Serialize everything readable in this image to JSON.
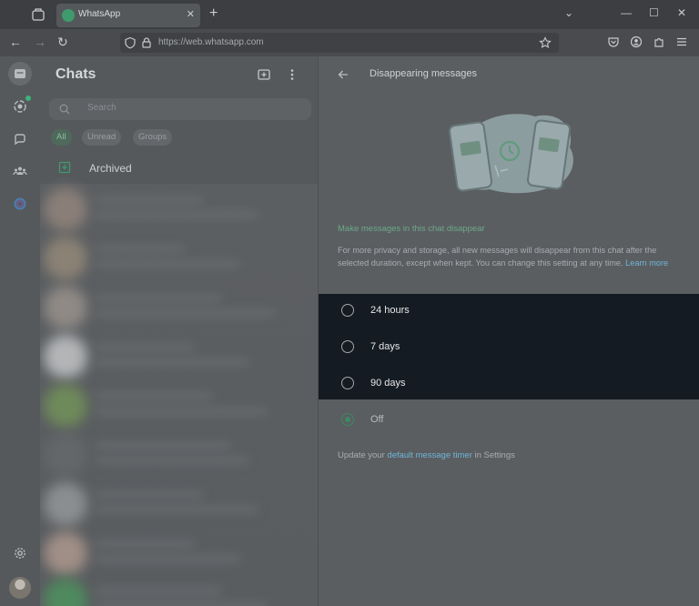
{
  "browser": {
    "tab_title": "WhatsApp",
    "url": "https://web.whatsapp.com"
  },
  "chat_list": {
    "title": "Chats",
    "search_placeholder": "Search",
    "filters": [
      "All",
      "Unread",
      "Groups"
    ],
    "archived_label": "Archived"
  },
  "disappearing": {
    "title": "Disappearing messages",
    "subheading": "Make messages in this chat disappear",
    "description": "For more privacy and storage, all new messages will disappear from this chat after the selected duration, except when kept. You can change this setting at any time.",
    "learn_more": "Learn more",
    "options": [
      {
        "label": "24 hours",
        "selected": false
      },
      {
        "label": "7 days",
        "selected": false
      },
      {
        "label": "90 days",
        "selected": false
      },
      {
        "label": "Off",
        "selected": true
      }
    ],
    "footer_prefix": "Update your",
    "footer_link": "default message timer",
    "footer_suffix": "in Settings"
  },
  "colors": {
    "accent": "#3a8a63",
    "link": "#6eb5d8",
    "highlight_bg": "#151b22"
  }
}
